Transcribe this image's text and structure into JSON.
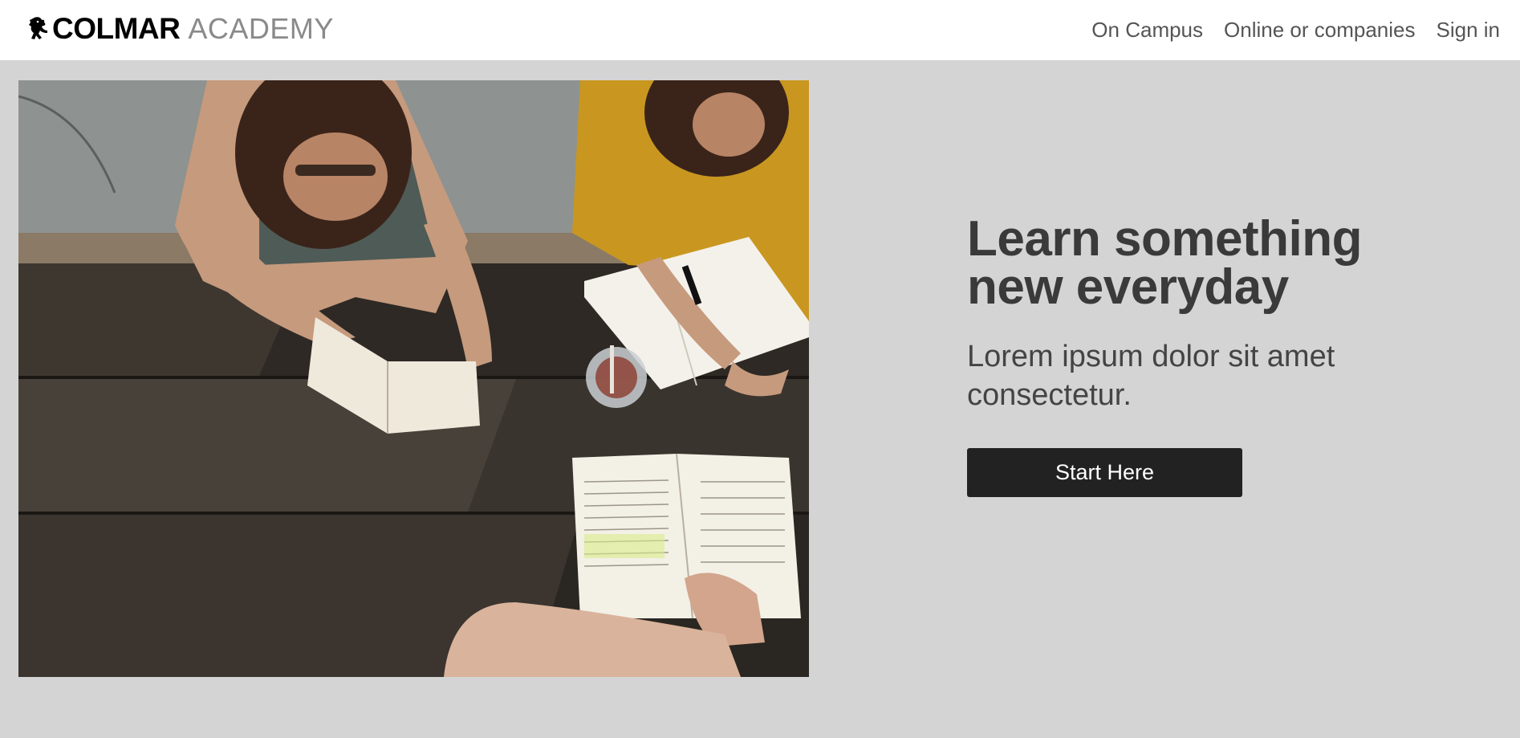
{
  "brand": {
    "name_bold": "COLMAR",
    "name_light": "ACADEMY",
    "icon": "lion-rampant-icon"
  },
  "nav": {
    "items": [
      {
        "label": "On Campus"
      },
      {
        "label": "Online or companies"
      },
      {
        "label": "Sign in"
      }
    ]
  },
  "hero": {
    "image_alt": "Students reading and writing at a wooden picnic table",
    "headline_line1": "Learn something",
    "headline_line2": "new everyday",
    "subline_line1": "Lorem ipsum dolor sit amet",
    "subline_line2": "consectetur.",
    "cta_label": "Start Here"
  },
  "colors": {
    "header_bg": "#ffffff",
    "page_bg": "#d4d4d4",
    "text": "#3a3a3a",
    "button_bg": "#232222",
    "button_text": "#ffffff"
  }
}
